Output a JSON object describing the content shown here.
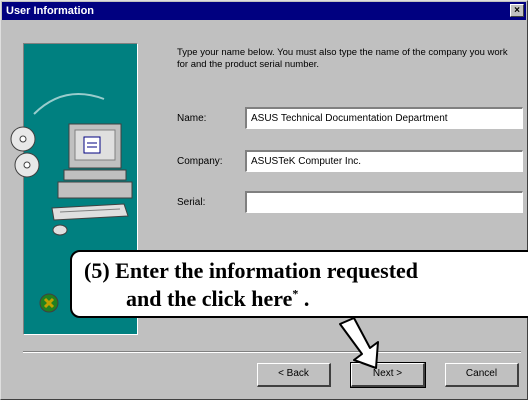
{
  "window": {
    "title": "User Information",
    "close_glyph": "×"
  },
  "main": {
    "instructions": "Type your name below. You must also type the name of the company you work for and the product serial number.",
    "fields": [
      {
        "label": "Name:",
        "value": "ASUS Technical Documentation Department"
      },
      {
        "label": "Company:",
        "value": "ASUSTeK Computer Inc."
      },
      {
        "label": "Serial:",
        "value": ""
      }
    ]
  },
  "buttons": {
    "back": "< Back",
    "next": "Next >",
    "cancel": "Cancel"
  },
  "callout": {
    "line1": "(5)  Enter the information requested",
    "line2": "and the click here",
    "asterisk": "*",
    "line2_end": " ."
  },
  "colors": {
    "title_bar": "#000080",
    "dialog_face": "#c0c0c0",
    "art_panel": "#008080"
  },
  "icons": [
    "computer-icon",
    "cd-disc-icon",
    "arrow-pointer-icon"
  ]
}
